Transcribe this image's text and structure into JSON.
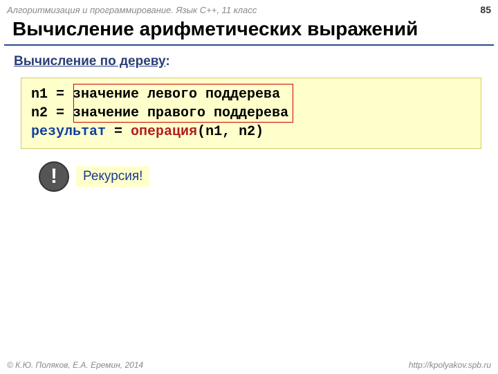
{
  "header": {
    "course": "Алгоритмизация и программирование. Язык C++, 11 класс",
    "page": "85"
  },
  "title": "Вычисление арифметических выражений",
  "subtitle_prefix": "Вычисление по дереву",
  "subtitle_colon": ":",
  "code": {
    "l1a": "n1 = ",
    "l1b": "значение левого поддерева",
    "l2a": "n2 = ",
    "l2b": "значение правого поддерева",
    "l3a": "результат",
    "l3b": " = ",
    "l3c": "операция",
    "l3d": "(n1, n2)"
  },
  "callout": {
    "mark": "!",
    "text": "Рекурсия!"
  },
  "footer": {
    "left": "© К.Ю. Поляков, Е.А. Еремин, 2014",
    "right": "http://kpolyakov.spb.ru"
  }
}
